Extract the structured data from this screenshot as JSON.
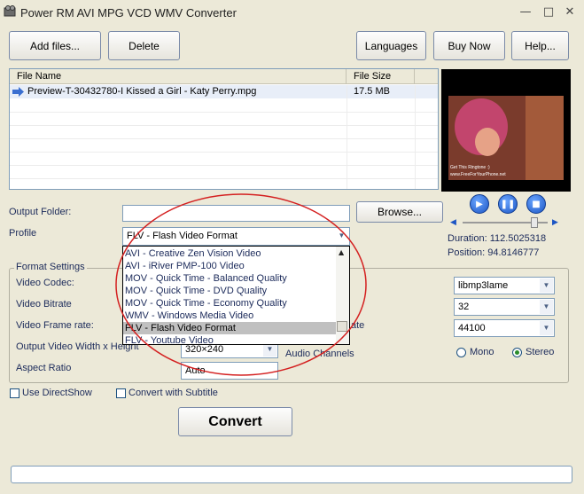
{
  "window": {
    "title": "Power RM AVI MPG VCD WMV Converter",
    "minimize": "—",
    "maximize": "□",
    "close": "✕"
  },
  "toolbar": {
    "add_files": "Add files...",
    "delete": "Delete",
    "languages": "Languages",
    "buy_now": "Buy Now",
    "help": "Help..."
  },
  "file_list": {
    "columns": [
      "File Name",
      "File Size"
    ],
    "rows": [
      {
        "name": "Preview-T-30432780-I Kissed a Girl - Katy Perry.mpg",
        "size": "17.5 MB"
      }
    ]
  },
  "preview": {
    "overlay_line1": "Get This Ringtone :)",
    "overlay_line2": "www.FreeForYourPhone.net",
    "duration": "Duration: 112.5025318",
    "position": "Position: 94.8146777",
    "progress": 0.84
  },
  "output": {
    "folder_label": "Output Folder:",
    "folder_value": "",
    "browse": "Browse...",
    "profile_label": "Profile",
    "profile_value": "FLV - Flash Video Format"
  },
  "profile_dropdown": {
    "items": [
      "AVI - Creative Zen Vision Video",
      "AVI - iRiver PMP-100 Video",
      "MOV - Quick Time - Balanced Quality",
      "MOV - Quick Time - DVD Quality",
      "MOV - Quick Time - Economy Quality",
      "WMV - Windows Media Video",
      "FLV - Flash Video Format",
      "FLV - Youtube Video"
    ],
    "selected_index": 6
  },
  "format_settings": {
    "title": "Format Settings",
    "video_codec": "Video Codec:",
    "video_bitrate": "Video Bitrate",
    "video_frame_rate": "Video Frame rate:",
    "output_size_label": "Output Video Width x Height",
    "output_size_value": "320×240",
    "aspect_ratio": "Aspect Ratio",
    "aspect_value": "Auto",
    "audio_rate_partial": "ate",
    "audio_channels": "Audio Channels",
    "audio_codec_value": "libmp3lame",
    "audio_bitrate_value": "32",
    "audio_rate_value": "44100",
    "mono": "Mono",
    "stereo": "Stereo",
    "stereo_selected": true
  },
  "options": {
    "use_directshow": "Use DirectShow",
    "convert_subtitle": "Convert with Subtitle"
  },
  "convert_button": "Convert",
  "colors": {
    "annotation_ellipse": "#d42020",
    "accent": "#1c55c4",
    "list_selected": "#e8eef8"
  }
}
